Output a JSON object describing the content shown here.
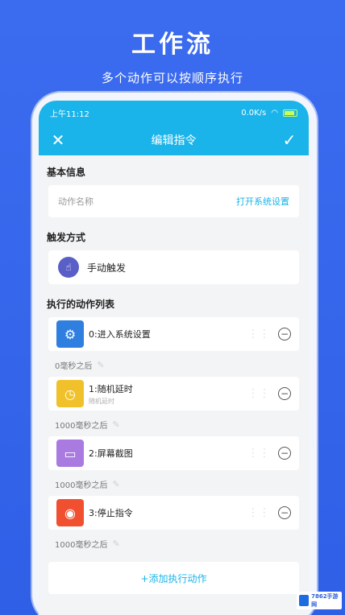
{
  "hero": {
    "title": "工作流",
    "subtitle": "多个动作可以按顺序执行"
  },
  "statusbar": {
    "time": "上午11:12",
    "net_speed": "0.0K/s",
    "battery_icon": "battery-icon"
  },
  "appbar": {
    "close_icon": "✕",
    "title": "编辑指令",
    "confirm_icon": "✓"
  },
  "basic_info": {
    "section_title": "基本信息",
    "name_label": "动作名称",
    "name_value": "打开系统设置"
  },
  "trigger": {
    "section_title": "触发方式",
    "label": "手动触发"
  },
  "actions": {
    "section_title": "执行的动作列表",
    "items": [
      {
        "label": "0:进入系统设置",
        "sub": "",
        "color": "#2e7fe0",
        "icon": "settings-icon"
      },
      {
        "label": "1:随机延时",
        "sub": "随机延时",
        "color": "#f1c12b",
        "icon": "clock-icon"
      },
      {
        "label": "2:屏幕截图",
        "sub": "",
        "color": "#a97be0",
        "icon": "image-icon"
      },
      {
        "label": "3:停止指令",
        "sub": "",
        "color": "#f05030",
        "icon": "stop-icon"
      }
    ],
    "delays": [
      "0毫秒之后",
      "1000毫秒之后",
      "1000毫秒之后",
      "1000毫秒之后"
    ]
  },
  "add_action_label": "+添加执行动作",
  "watermark": "7862手游网"
}
